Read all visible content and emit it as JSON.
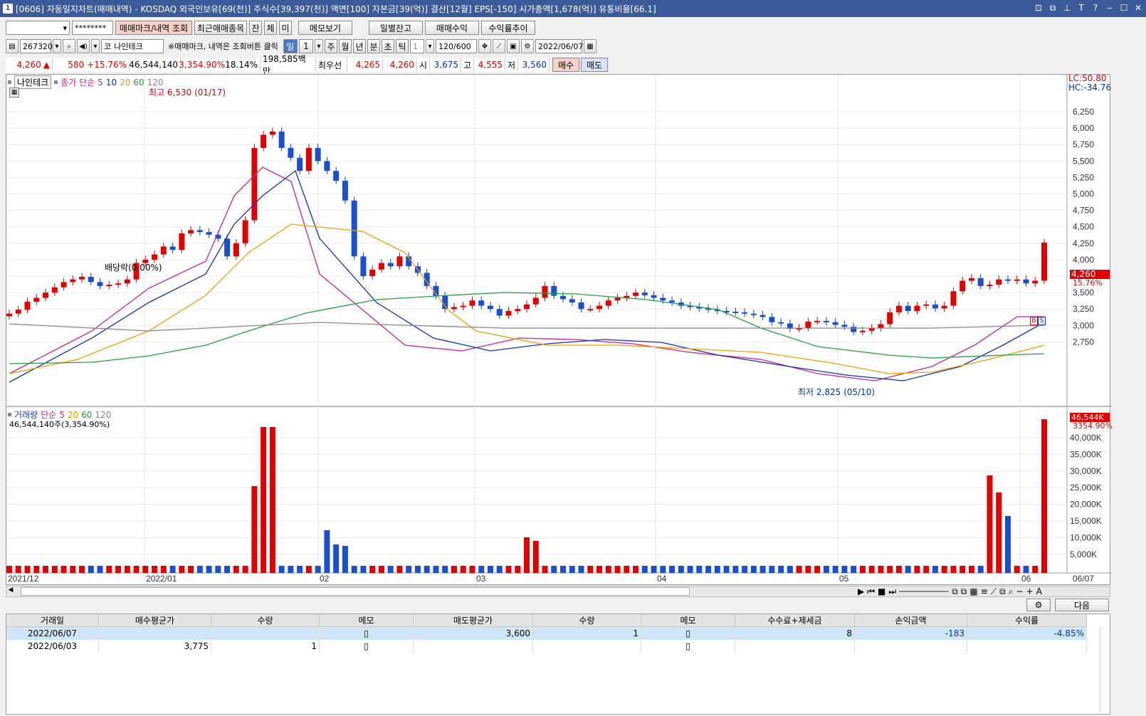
{
  "title": {
    "icon": "1",
    "text": "[0606] 자동일지차트(매매내역) - KOSDAQ 외국인보유[69(천)] 주식수[39,397(천)] 액면[100] 자본금[39(억)] 결산[12월] EPS[-150] 시가총액[1,678(억)] 유통비율[66.1]"
  },
  "toolbar1": {
    "account_value": "",
    "password_value": "********",
    "btn_mark": "매매마크/내역 조회",
    "btn_recent": "최근매매종목",
    "btn_jan": "잔",
    "btn_che": "체",
    "btn_mi": "미",
    "btn_memo": "메모보기",
    "btn_daily": "일별잔고",
    "btn_profit": "매매수익",
    "btn_trend": "수익률추이"
  },
  "toolbar2": {
    "code": "267320",
    "stock_prefix": "코",
    "stock_name": "나인테크",
    "hint": "※매매마크, 내역은 조회버튼 클릭",
    "periods": [
      "일",
      "1",
      "주",
      "월",
      "년",
      "분",
      "초",
      "틱"
    ],
    "interval": "1",
    "count": "120/600",
    "date": "2022/06/07"
  },
  "price_row": {
    "price": "4,260",
    "arrow": "▲",
    "change": "580",
    "change_pct": "+15.76%",
    "volume": "46,544,140",
    "vol_ratio": "3,354.90%",
    "turnover": "18.14%",
    "amount": "198,585백만",
    "best_label": "최우선",
    "ask": "4,265",
    "bid": "4,260",
    "open_label": "시",
    "open": "3,675",
    "high_label": "고",
    "high": "4,555",
    "low_label": "저",
    "low": "3,560",
    "buy_btn": "매수",
    "sell_btn": "매도"
  },
  "legend_price": {
    "name": "나인테크",
    "ma_label": "종가 단순",
    "ma": [
      "5",
      "10",
      "20",
      "60",
      "120"
    ]
  },
  "legend_volume": {
    "name": "거래량",
    "ma_label": "단순",
    "ma": [
      "5",
      "20",
      "60",
      "120"
    ],
    "sub": "46,544,140주(3,354.90%)"
  },
  "annotations": {
    "high": "최고 6,530 (01/17)",
    "low": "최저 2,825 (05/10)",
    "dividend": "배당락(0.00%)",
    "lc": "LC:50.80",
    "hc": "HC:-34.76",
    "cur_price": "4,260",
    "cur_pct": "15.76%",
    "cur_vol": "46,544K",
    "cur_vol_pct": "3354.90%",
    "buy_mark": "B",
    "sell_mark": "S"
  },
  "chart_data": {
    "type": "candlestick",
    "price_axis": [
      "6,250",
      "6,000",
      "5,750",
      "5,500",
      "5,250",
      "5,000",
      "4,750",
      "4,500",
      "4,250",
      "4,000",
      "3,750",
      "3,500",
      "3,250",
      "3,000",
      "2,750"
    ],
    "volume_axis": [
      "40,000K",
      "35,000K",
      "30,000K",
      "25,000K",
      "20,000K",
      "15,000K",
      "10,000K",
      "5,000K"
    ],
    "x_labels": [
      "2021/12",
      "2022/01",
      "02",
      "03",
      "04",
      "05",
      "06",
      "06/07"
    ],
    "price_range": [
      2700,
      6600
    ],
    "volume_range": [
      0,
      46544
    ]
  },
  "table": {
    "headers": [
      "거래일",
      "매수평균가",
      "수량",
      "메모",
      "매도평균가",
      "수량",
      "메모",
      "수수료+제세금",
      "손익금액",
      "수익률"
    ],
    "rows": [
      [
        "2022/06/07",
        "",
        "",
        "",
        "3,600",
        "1",
        "",
        "8",
        "-183",
        "-4.85%"
      ],
      [
        "2022/06/03",
        "3,775",
        "1",
        "",
        "",
        "",
        "",
        "",
        "",
        ""
      ]
    ],
    "btn_next": "다음"
  }
}
